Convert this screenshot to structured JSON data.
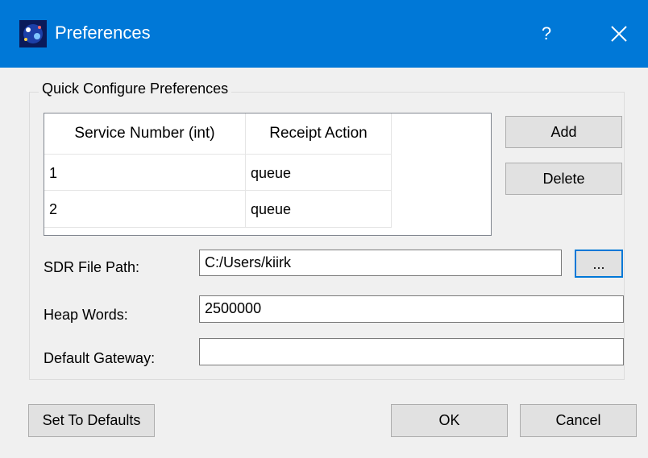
{
  "window": {
    "title": "Preferences",
    "help_glyph": "?",
    "close_icon": "close-icon",
    "app_icon": "app-icon"
  },
  "colors": {
    "titlebar": "#0078d7",
    "focus_border": "#0078d7"
  },
  "group": {
    "title": "Quick Configure Preferences"
  },
  "table": {
    "headers": [
      "Service Number (int)",
      "Receipt Action"
    ],
    "rows": [
      [
        "1",
        "queue"
      ],
      [
        "2",
        "queue"
      ]
    ]
  },
  "buttons": {
    "add": "Add",
    "delete": "Delete",
    "browse": "...",
    "defaults": "Set To Defaults",
    "ok": "OK",
    "cancel": "Cancel"
  },
  "fields": {
    "sdr_label": "SDR File Path:",
    "sdr_value": "C:/Users/kiirk",
    "heap_label": "Heap Words:",
    "heap_value": "2500000",
    "gateway_label": "Default Gateway:",
    "gateway_value": ""
  }
}
